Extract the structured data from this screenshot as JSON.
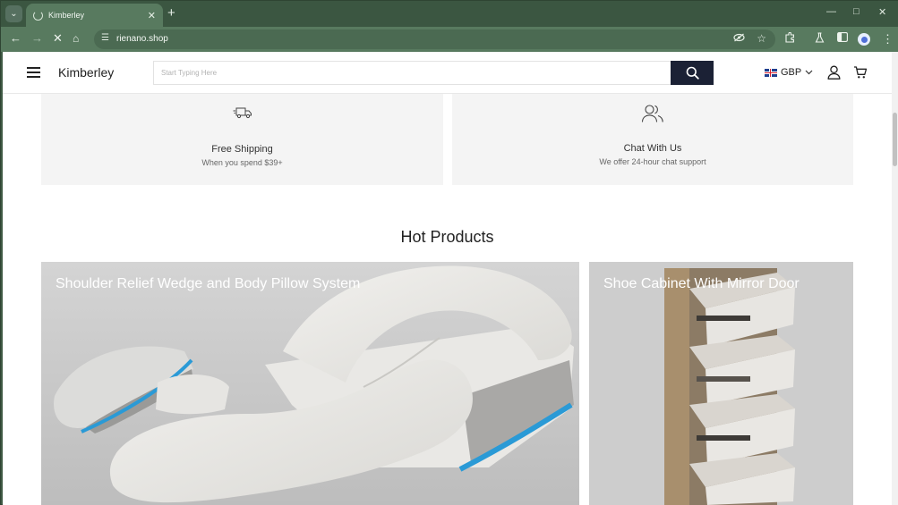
{
  "browser": {
    "tab_title": "Kimberley",
    "new_tab_symbol": "+",
    "url": "rienano.shop"
  },
  "header": {
    "brand": "Kimberley",
    "search_placeholder": "Start Typing Here",
    "currency": "GBP"
  },
  "features": [
    {
      "title": "Free Shipping",
      "subtitle": "When you spend $39+",
      "icon": "delivery-truck-icon"
    },
    {
      "title": "Chat With Us",
      "subtitle": "We offer 24-hour chat support",
      "icon": "users-icon"
    }
  ],
  "hot_products": {
    "title": "Hot Products",
    "items": [
      {
        "name": "Shoulder Relief Wedge and Body Pillow System"
      },
      {
        "name": "Shoe Cabinet With Mirror Door"
      }
    ]
  }
}
